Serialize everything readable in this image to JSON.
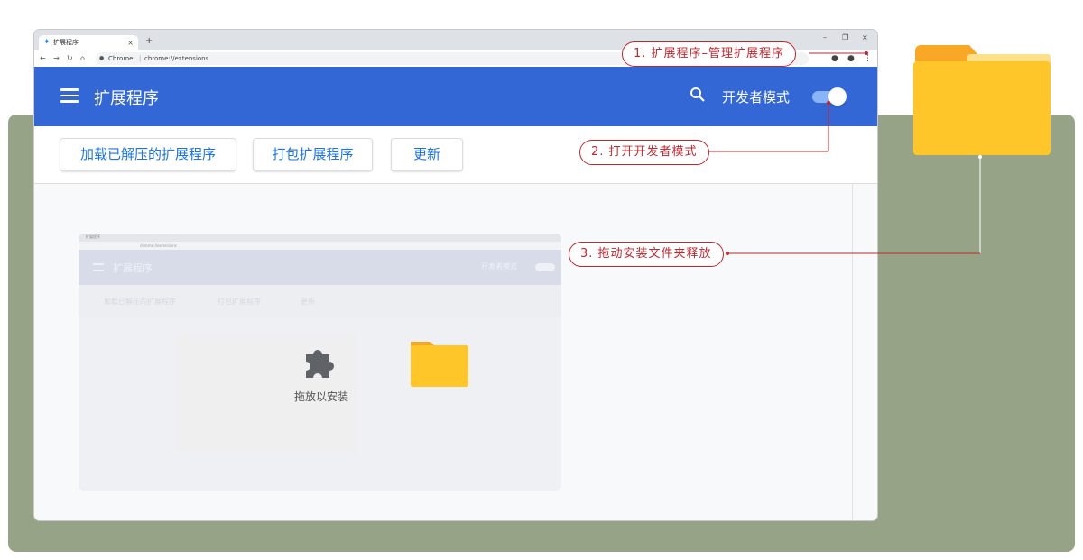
{
  "browser": {
    "tab": {
      "label": "扩展程序",
      "close": "×"
    },
    "new_tab": "+",
    "window_controls": {
      "minimize": "–",
      "restore": "❐",
      "close": "×"
    },
    "address": {
      "chip": "Chrome",
      "separator": "|",
      "url": "chrome://extensions"
    }
  },
  "extensions_page": {
    "title": "扩展程序",
    "developer_mode_label": "开发者模式",
    "developer_mode_on": true,
    "buttons": {
      "load_unpacked": "加载已解压的扩展程序",
      "pack": "打包扩展程序",
      "update": "更新"
    }
  },
  "inner_screenshot": {
    "tab_label": "扩展程序",
    "url": "chrome://extensions",
    "title": "扩展程序",
    "developer_mode_label": "开发者模式",
    "buttons": [
      "加载已解压的扩展程序",
      "打包扩展程序",
      "更新"
    ],
    "drop_label": "拖放以安装"
  },
  "annotations": {
    "step1": "1. 扩展程序–管理扩展程序",
    "step2": "2. 打开开发者模式",
    "step3": "3. 拖动安装文件夹释放"
  },
  "colors": {
    "header_blue": "#3367d6",
    "annotation_red": "#c1272d",
    "background_green": "#97a387",
    "folder_yellow": "#ffc629"
  }
}
